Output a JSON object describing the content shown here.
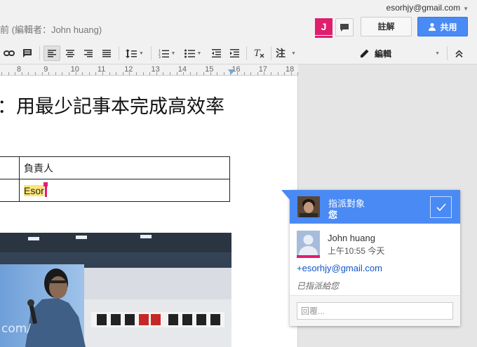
{
  "header": {
    "account_email": "esorhjy@gmail.com",
    "last_edit": "前 (編輯者：John huang)",
    "collaborator_initial": "J",
    "comments_label": "註解",
    "share_label": "共用"
  },
  "toolbar": {
    "style_label": "注",
    "mode_label": "編輯"
  },
  "ruler": {
    "numbers": [
      "8",
      "9",
      "10",
      "11",
      "12",
      "13",
      "14",
      "15",
      "16",
      "17",
      "18"
    ]
  },
  "document": {
    "title": "：用最少記事本完成高效率",
    "table": [
      [
        "",
        "負責人"
      ],
      [
        "",
        "Esor"
      ]
    ]
  },
  "comment": {
    "assign_label": "指派對象",
    "assign_target": "您",
    "author": "John huang",
    "time": "上午10:55 今天",
    "mention": "+esorhjy@gmail.com",
    "assigned_note": "已指派給您",
    "reply_placeholder": "回覆..."
  },
  "colors": {
    "accent_blue": "#4a8af4",
    "collaborator_pink": "#e01e6e",
    "highlight_yellow": "#fce57a"
  }
}
